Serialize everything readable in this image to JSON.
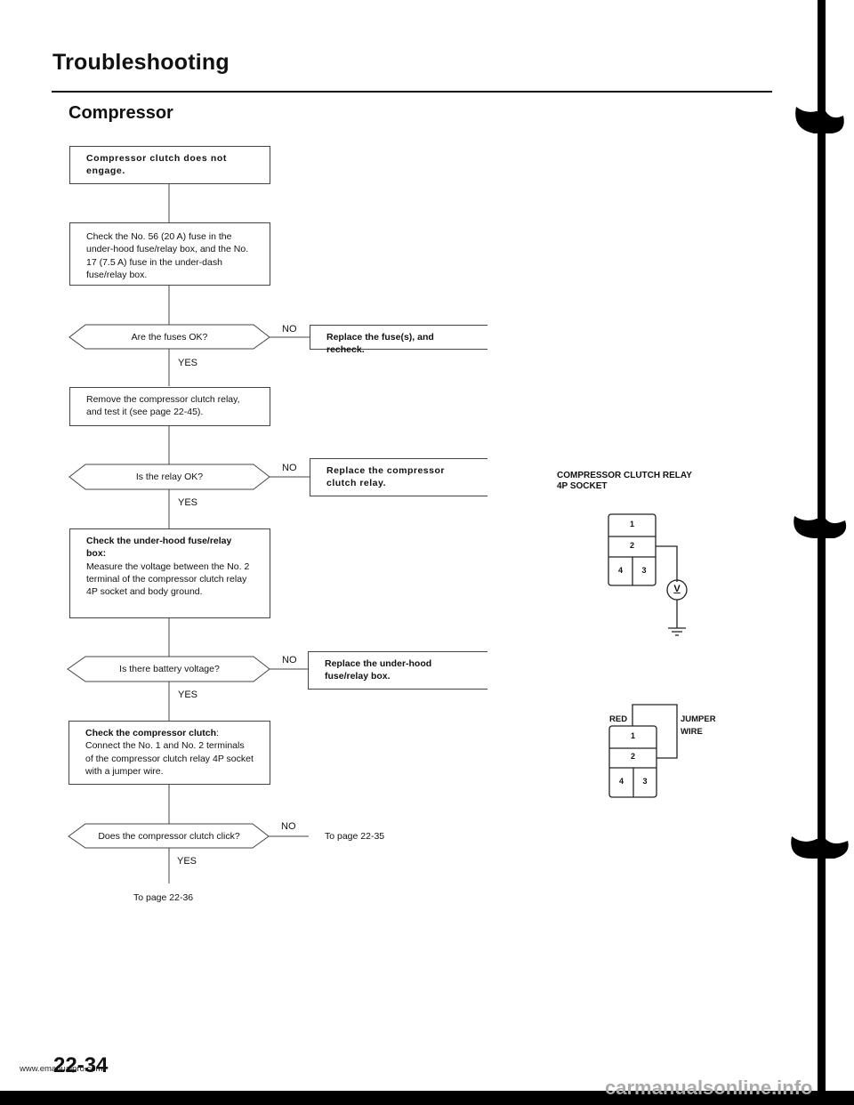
{
  "page": {
    "title": "Troubleshooting",
    "subtitle": "Compressor",
    "page_number": "22-34",
    "watermark_left": "www.emanualpro.com",
    "watermark_right": "carmanualsonline.info"
  },
  "flowchart": {
    "start": "Compressor clutch does not engage.",
    "step1": "Check the No. 56 (20 A) fuse in the under-hood fuse/relay box, and the No. 17 (7.5 A) fuse in the under-dash fuse/relay box.",
    "q1": "Are the fuses OK?",
    "q1_no_action": "Replace the fuse(s), and recheck.",
    "step2": "Remove the compressor clutch relay, and test it (see page 22-45).",
    "q2": "Is the relay OK?",
    "q2_no_action": "Replace the compressor clutch relay.",
    "step3_heading": "Check the under-hood fuse/relay box:",
    "step3_body": "Measure the voltage between the No. 2 terminal of the compressor clutch relay 4P socket and body ground.",
    "q3": "Is there battery voltage?",
    "q3_no_action": "Replace the under-hood fuse/relay box.",
    "step4_heading": "Check the compressor clutch",
    "step4_body": "Connect the No. 1 and No. 2 terminals of the compressor clutch relay 4P socket with a jumper wire.",
    "q4": "Does the compressor clutch click?",
    "q4_no_ref": "To page 22-35",
    "q4_yes_ref": "To page 22-36",
    "yes_label": "YES",
    "no_label": "NO"
  },
  "diagram": {
    "title_line1": "COMPRESSOR CLUTCH RELAY",
    "title_line2": "4P SOCKET",
    "pins": [
      "1",
      "2",
      "4",
      "3"
    ],
    "meter_symbol": "V",
    "red_label": "RED",
    "jumper_label_line1": "JUMPER",
    "jumper_label_line2": "WIRE"
  }
}
